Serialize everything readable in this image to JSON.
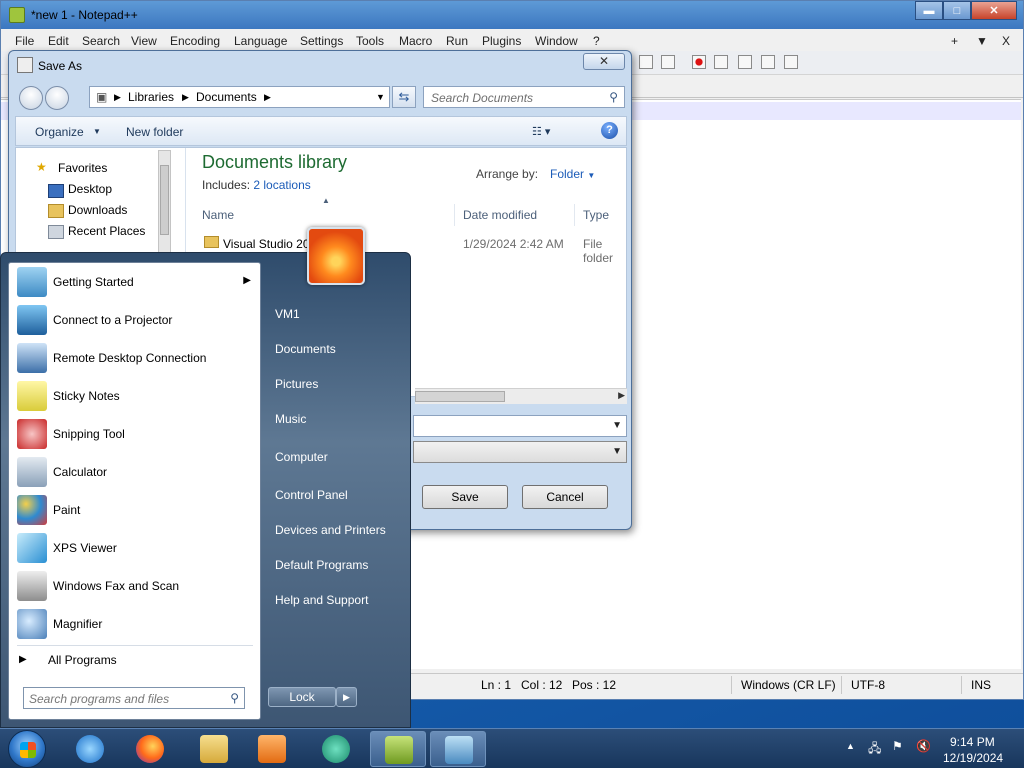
{
  "notepadpp": {
    "title": "*new 1 - Notepad++",
    "menu": [
      "File",
      "Edit",
      "Search",
      "View",
      "Encoding",
      "Language",
      "Settings",
      "Tools",
      "Macro",
      "Run",
      "Plugins",
      "Window",
      "?"
    ],
    "menu_right": [
      "+",
      "▼",
      "X"
    ],
    "window_buttons": {
      "minimize": "▬",
      "maximize": "□",
      "close": "✕"
    },
    "status": {
      "ln": "Ln : 1",
      "col": "Col : 12",
      "pos": "Pos : 12",
      "eol": "Windows (CR LF)",
      "encoding": "UTF-8",
      "mode": "INS"
    }
  },
  "save_as": {
    "title": "Save As",
    "close": "✕",
    "breadcrumb": [
      "Libraries",
      "Documents"
    ],
    "search_placeholder": "Search Documents",
    "organize": "Organize",
    "new_folder": "New folder",
    "favorites": {
      "header": "Favorites",
      "items": [
        "Desktop",
        "Downloads",
        "Recent Places"
      ]
    },
    "library_title": "Documents library",
    "includes_label": "Includes:",
    "includes_link": "2 locations",
    "arrange_by_label": "Arrange by:",
    "arrange_by_value": "Folder",
    "columns": [
      "Name",
      "Date modified",
      "Type"
    ],
    "files": [
      {
        "name": "Visual Studio 2010",
        "date": "1/29/2024 2:42 AM",
        "type": "File folder"
      }
    ],
    "save_button": "Save",
    "cancel_button": "Cancel"
  },
  "start_menu": {
    "programs": [
      {
        "label": "Getting Started",
        "icon": "getting-started-icon",
        "has_submenu": true
      },
      {
        "label": "Connect to a Projector",
        "icon": "projector-icon"
      },
      {
        "label": "Remote Desktop Connection",
        "icon": "remote-desktop-icon"
      },
      {
        "label": "Sticky Notes",
        "icon": "sticky-notes-icon"
      },
      {
        "label": "Snipping Tool",
        "icon": "snipping-tool-icon"
      },
      {
        "label": "Calculator",
        "icon": "calculator-icon"
      },
      {
        "label": "Paint",
        "icon": "paint-icon"
      },
      {
        "label": "XPS Viewer",
        "icon": "xps-viewer-icon"
      },
      {
        "label": "Windows Fax and Scan",
        "icon": "fax-scan-icon"
      },
      {
        "label": "Magnifier",
        "icon": "magnifier-icon"
      }
    ],
    "all_programs": "All Programs",
    "search_placeholder": "Search programs and files",
    "right_links": [
      "VM1",
      "Documents",
      "Pictures",
      "Music",
      "Computer",
      "Control Panel",
      "Devices and Printers",
      "Default Programs",
      "Help and Support"
    ],
    "lock_button": "Lock"
  },
  "taskbar": {
    "apps": [
      "internet-explorer-icon",
      "firefox-icon",
      "file-explorer-icon",
      "media-player-icon",
      "chat-app-icon",
      "notepadpp-icon",
      "photo-viewer-icon"
    ],
    "clock_time": "9:14 PM",
    "clock_date": "12/19/2024"
  },
  "colors": {
    "library_title": "#1e6b32",
    "link": "#1c5cb8",
    "taskbar": "#18365c"
  }
}
